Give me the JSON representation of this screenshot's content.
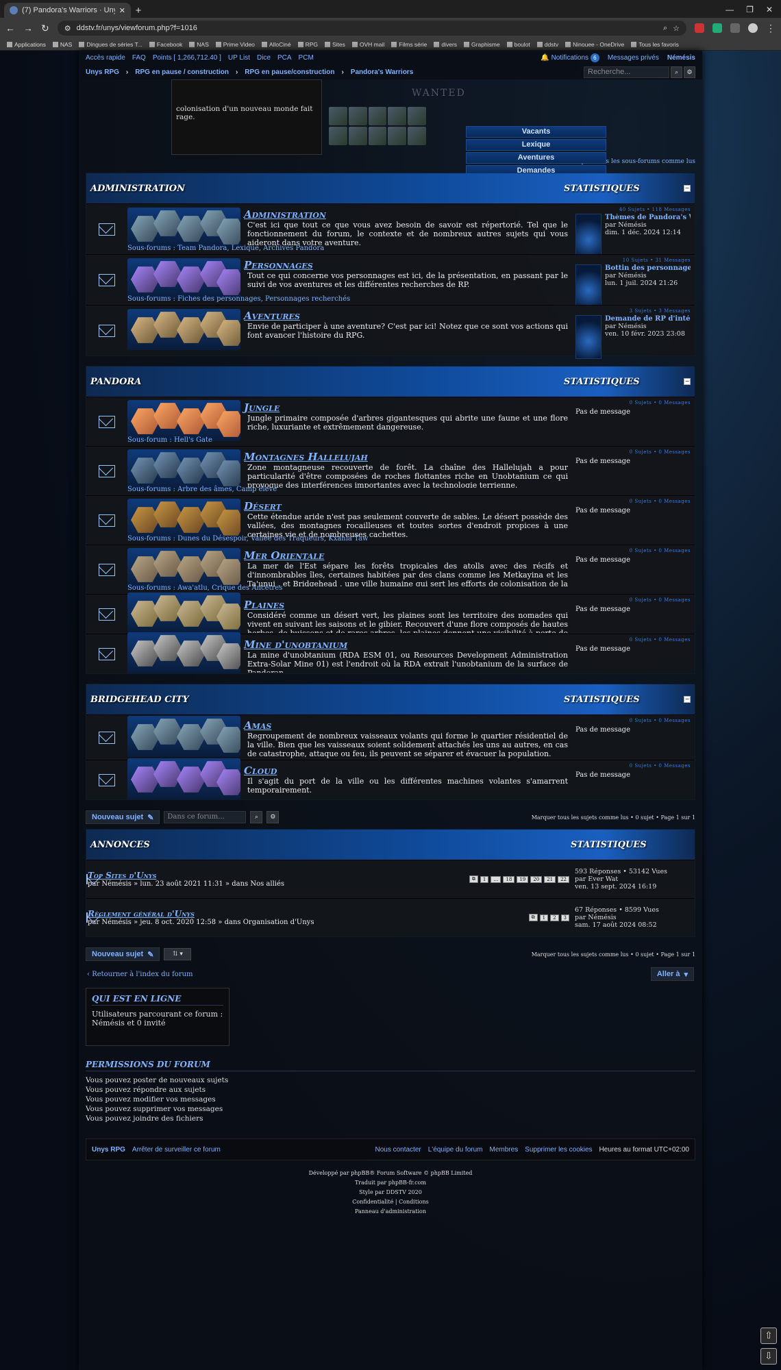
{
  "browser": {
    "tab_title": "(7) Pandora's Warriors · Unys",
    "url": "ddstv.fr/unys/viewforum.php?f=1016",
    "bookmarks": [
      "Applications",
      "NAS",
      "Dingues de séries T...",
      "Facebook",
      "NAS",
      "Prime Video",
      "AlloCiné",
      "RPG",
      "Sites",
      "OVH mail",
      "Films série",
      "divers",
      "Graphisme",
      "boulot",
      "ddstv",
      "Ninouee - OneDrive",
      "Tous les favoris"
    ]
  },
  "topnav": {
    "quick": "Accès rapide",
    "faq": "FAQ",
    "points": "Points [ 1,266,712.40 ]",
    "up": "UP List",
    "dice": "Dice",
    "pca": "PCA",
    "pcm": "PCM",
    "notifications": "Notifications",
    "notif_count": "6",
    "pm": "Messages privés",
    "user": "Némésis",
    "crumbs": [
      "Unys RPG",
      "RPG en pause / construction",
      "RPG en pause/construction",
      "Pandora's Warriors"
    ],
    "search_placeholder": "Recherche..."
  },
  "header": {
    "text": "colonisation d'un nouveau monde fait rage.",
    "wanted": "WANTED",
    "menu": [
      "Vacants",
      "Lexique",
      "Aventures",
      "Demandes"
    ]
  },
  "mark_subforums": "Marquer tous les sous-forums comme lus",
  "categories": [
    {
      "name": "ADMINISTRATION",
      "stat": "STATISTIQUES",
      "forums": [
        {
          "title": "Administration",
          "desc": "C'est ici que tout ce que vous avez besoin de savoir est répertorié. Tel que le fonctionnement du forum, le contexte et de nombreux autres sujets qui vous aideront dans votre aventure.",
          "sub": "Sous-forums : Team Pandora, Lexique, Archives Pandora",
          "counts": "40 Sujets • 118 Messages",
          "last_title": "Thèmes de Pandora's Wa...",
          "last_by": "par Némésis",
          "last_date": "dim. 1 déc. 2024 12:14"
        },
        {
          "title": "Personnages",
          "desc": "Tout ce qui concerne vos personnages est ici, de la présentation, en passant par le suivi de vos aventures et les différentes recherches de RP.",
          "sub": "Sous-forums : Fiches des personnages, Personnages recherchés",
          "counts": "10 Sujets • 31 Messages",
          "last_title": "Bottin des personnages j...",
          "last_by": "par Némésis",
          "last_date": "lun. 1 juil. 2024 21:26"
        },
        {
          "title": "Aventures",
          "desc": "Envie de participer à une aventure? C'est par ici! Notez que ce sont vos actions qui font avancer l'histoire du RPG.",
          "sub": "",
          "counts": "3 Sujets • 3 Messages",
          "last_title": "Demande de RP d'intégra...",
          "last_by": "par Némésis",
          "last_date": "ven. 10 févr. 2023 23:08"
        }
      ]
    },
    {
      "name": "PANDORA",
      "stat": "STATISTIQUES",
      "forums": [
        {
          "title": "Jungle",
          "desc": "Jungle primaire composée d'arbres gigantesques qui abrite une faune et une flore riche, luxuriante et extrêmement dangereuse.",
          "sub": "Sous-forum : Hell's Gate",
          "counts": "0 Sujets • 0 Messages",
          "last_title": "",
          "last_by": "Pas de message",
          "last_date": ""
        },
        {
          "title": "Montagnes Hallelujah",
          "desc": "Zone montagneuse recouverte de forêt. La chaîne des Hallelujah a pour particularité d'être composées de roches flottantes riche en Unobtanium ce qui provoque des interférences importantes avec la technologie terrienne.",
          "sub": "Sous-forums : Arbre des âmes, Camp élevé",
          "counts": "0 Sujets • 0 Messages",
          "last_title": "",
          "last_by": "Pas de message",
          "last_date": ""
        },
        {
          "title": "Désert",
          "desc": "Cette étendue aride n'est pas seulement couverte de sables. Le désert possède des vallées, des montagnes rocailleuses et toutes sortes d'endroit propices à une certaines vie et de nombreuses cachettes.",
          "sub": "Sous-forums : Dunes du Désespoir, Vallée des Traqueurs, Kxania Taw",
          "counts": "0 Sujets • 0 Messages",
          "last_title": "",
          "last_by": "Pas de message",
          "last_date": ""
        },
        {
          "title": "Mer Orientale",
          "desc": "La mer de l'Est sépare les forêts tropicales des atolls avec des récifs et d'innombrables îles, certaines habitées par des clans comme les Metkayina et les Ta'unui , et Bridgehead , une ville humaine qui sert les efforts de colonisation de la RDA.",
          "sub": "Sous-forums : Awa'atlu, Crique des Ancêtres",
          "counts": "0 Sujets • 0 Messages",
          "last_title": "",
          "last_by": "Pas de message",
          "last_date": ""
        },
        {
          "title": "Plaines",
          "desc": "Considéré comme un désert vert, les plaines sont les territoire des nomades qui vivent en suivant les saisons et le gibier. Recouvert d'une flore composés de hautes herbes, de buissons et de rares arbres, les plaines donnent une visibilité à perte de vue à ceux qui les parcourent.",
          "sub": "",
          "counts": "0 Sujets • 0 Messages",
          "last_title": "",
          "last_by": "Pas de message",
          "last_date": ""
        },
        {
          "title": "Mine d'unobtanium",
          "desc": "La mine d'unobtanium (RDA ESM 01, ou Resources Development Administration Extra-Solar Mine 01) est l'endroit où la RDA extrait l'unobtanium de la surface de Pandoran.",
          "sub": "",
          "counts": "0 Sujets • 0 Messages",
          "last_title": "",
          "last_by": "Pas de message",
          "last_date": ""
        }
      ]
    },
    {
      "name": "BRIDGEHEAD CITY",
      "stat": "STATISTIQUES",
      "forums": [
        {
          "title": "Amas",
          "desc": "Regroupement de nombreux vaisseaux volants qui forme le quartier résidentiel de la ville. Bien que les vaisseaux soient solidement attachés les uns au autres, en cas de catastrophe, attaque ou feu, ils peuvent se séparer et évacuer la population.",
          "sub": "",
          "counts": "0 Sujets • 0 Messages",
          "last_title": "",
          "last_by": "Pas de message",
          "last_date": ""
        },
        {
          "title": "Cloud",
          "desc": "Il s'agit du port de la ville ou les différentes machines volantes s'amarrent temporairement.",
          "sub": "",
          "counts": "0 Sujets • 0 Messages",
          "last_title": "",
          "last_by": "Pas de message",
          "last_date": ""
        }
      ]
    }
  ],
  "actions": {
    "new_topic": "Nouveau sujet",
    "search_placeholder": "Dans ce forum...",
    "pagination": "Marquer tous les sujets comme lus • 0 sujet • Page 1 sur 1"
  },
  "announcements": {
    "name": "ANNONCES",
    "stat": "STATISTIQUES",
    "items": [
      {
        "title": "Top Sites d'Unys",
        "meta": "par Némésis » lun. 23 août 2021 11:31 » dans Nos alliés",
        "pages": [
          "1",
          "…",
          "18",
          "19",
          "20",
          "21",
          "22"
        ],
        "stats": "593 Réponses • 53142 Vues",
        "last_by": "par Ever Wat",
        "last_date": "ven. 13 sept. 2024 16:19"
      },
      {
        "title": "Règlement général d'Unys",
        "meta": "par Némésis » jeu. 8 oct. 2020 12:58 » dans Organisation d'Unys",
        "pages": [
          "1",
          "2",
          "3"
        ],
        "stats": "67 Réponses • 8599 Vues",
        "last_by": "par Némésis",
        "last_date": "sam. 17 août 2024 08:52"
      }
    ]
  },
  "back": "Retourner à l'index du forum",
  "jump": "Aller à",
  "online": {
    "title": "QUI EST EN LIGNE",
    "l1": "Utilisateurs parcourant ce forum :",
    "l2": "Némésis et 0 invité"
  },
  "perms": {
    "title": "PERMISSIONS DU FORUM",
    "lines": [
      "Vous pouvez poster de nouveaux sujets",
      "Vous pouvez répondre aux sujets",
      "Vous pouvez modifier vos messages",
      "Vous pouvez supprimer vos messages",
      "Vous pouvez joindre des fichiers"
    ]
  },
  "footer": {
    "home": "Unys RPG",
    "stop": "Arrêter de surveiller ce forum",
    "contact": "Nous contacter",
    "team": "L'équipe du forum",
    "members": "Membres",
    "cookies": "Supprimer les cookies",
    "tz": "Heures au format UTC+02:00"
  },
  "credits": [
    "Développé par phpBB® Forum Software © phpBB Limited",
    "Traduit par phpBB-fr.com",
    "Style par DDSTV 2020",
    "Confidentialité | Conditions",
    "Panneau d'administration"
  ]
}
